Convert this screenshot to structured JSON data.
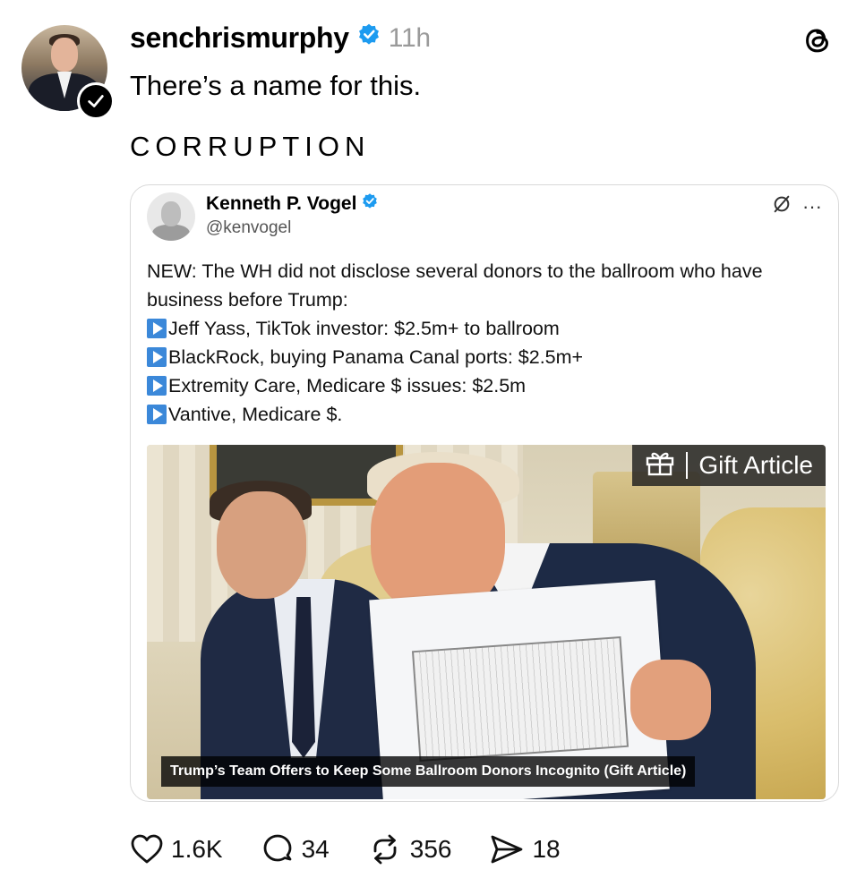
{
  "post": {
    "username": "senchrismurphy",
    "time": "11h",
    "text_line1": "There’s a name for this.",
    "text_line2": "CORRUPTION"
  },
  "quoted": {
    "name": "Kenneth P. Vogel",
    "handle": "@kenvogel",
    "more_label": "···",
    "intro_line1": "NEW: The WH did not disclose several donors to the ballroom who have",
    "intro_line2": "business before Trump:",
    "items": [
      "Jeff Yass, TikTok investor: $2.5m+ to ballroom",
      "BlackRock, buying Panama Canal ports: $2.5m+",
      "Extremity Care, Medicare $ issues: $2.5m",
      "Vantive, Medicare $."
    ],
    "gift_label": "Gift Article",
    "caption": "Trump’s Team Offers to Keep Some Ballroom Donors Incognito (Gift Article)"
  },
  "actions": {
    "likes": "1.6K",
    "comments": "34",
    "reposts": "356",
    "shares": "18"
  },
  "colors": {
    "verified_blue": "#1d9bf0",
    "play_blue": "#3b88d9",
    "time_gray": "#9a9a9a"
  },
  "icons": {
    "verified": "verified-icon",
    "threads": "threads-logo-icon",
    "like": "heart-icon",
    "comment": "comment-icon",
    "repost": "repost-icon",
    "share": "share-icon",
    "gift": "gift-icon",
    "grok": "grok-icon",
    "play": "play-icon"
  }
}
